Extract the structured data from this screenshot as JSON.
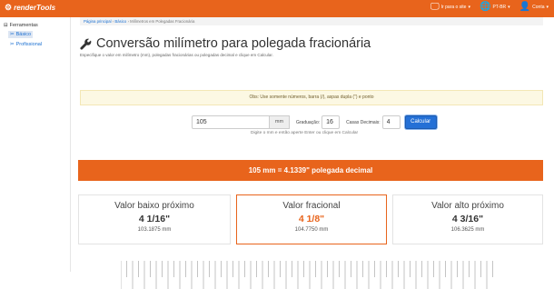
{
  "header": {
    "logo": "renderTools",
    "nav": [
      {
        "icon": "monitor-icon",
        "label": "Ir para o site"
      },
      {
        "icon": "globe-icon",
        "label": "PT-BR"
      },
      {
        "icon": "user-icon",
        "label": "Conta"
      }
    ]
  },
  "sidebar": {
    "root_label": "Ferramentas",
    "items": [
      {
        "label": "Básico",
        "active": true
      },
      {
        "label": "Profissional",
        "active": false
      }
    ]
  },
  "breadcrumb": {
    "items": [
      "Página principal",
      "Básico",
      "Milímetros em Polegadas Fracionária"
    ],
    "separator": "›"
  },
  "page": {
    "title": "Conversão milímetro para polegada fracionária",
    "subtitle": "Especifique o valor em milímetro (mm), polegadas fracionárias ou polegadas decimal e clique em Calcular."
  },
  "alert": {
    "text": "Obs: Use somente números, barra (/), aspas dupla (\") e ponto"
  },
  "calculator": {
    "mm_value": "105",
    "unit": "mm",
    "graduation_label": "Graduação:",
    "graduation_value": "16",
    "decimals_label": "Casas Decimais:",
    "decimals_value": "4",
    "calculate_label": "Calcular",
    "hint": "Digite o mm e então aperte Enter ou clique em Calcular"
  },
  "result": {
    "text": "105 mm = 4.1339\" polegada decimal"
  },
  "cards": [
    {
      "title": "Valor baixo próximo",
      "value": "4 1/16\"",
      "mm": "103.1875 mm"
    },
    {
      "title": "Valor fracional",
      "value": "4 1/8\"",
      "mm": "104.7750 mm"
    },
    {
      "title": "Valor alto próximo",
      "value": "4 3/16\"",
      "mm": "106.3625 mm"
    }
  ],
  "colors": {
    "brand": "#e8641c",
    "primary": "#2470d6",
    "alert_bg": "#fcf8e3"
  }
}
